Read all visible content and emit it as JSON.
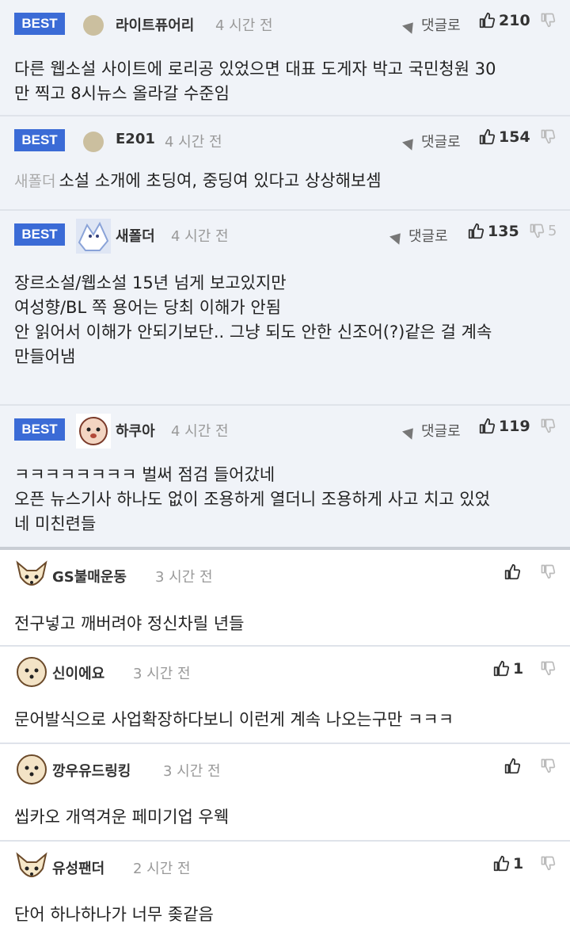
{
  "badge_label": "BEST",
  "reply_label": "댓글로",
  "best_comments": [
    {
      "nickname": "라이트퓨어리",
      "time": "4 시간 전",
      "upvotes": "210",
      "downvotes": "",
      "mention": "",
      "lines": [
        "다른 웹소설 사이트에 로리공 있었으면 대표 도게자 박고 국민청원 30",
        "만 찍고 8시뉴스 올라갈 수준임"
      ]
    },
    {
      "nickname": "E201",
      "time": "4 시간 전",
      "upvotes": "154",
      "downvotes": "",
      "mention": "새폴더",
      "lines": [
        "소설 소개에 초딩여, 중딩여 있다고 상상해보셈"
      ]
    },
    {
      "nickname": "새폴더",
      "time": "4 시간 전",
      "upvotes": "135",
      "downvotes": "5",
      "mention": "",
      "lines": [
        "장르소설/웹소설 15년 넘게 보고있지만",
        "",
        "여성향/BL 쪽 용어는 당최 이해가 안됨",
        "안 읽어서 이해가 안되기보단.. 그냥 되도 안한 신조어(?)같은 걸 계속",
        "만들어냄"
      ]
    },
    {
      "nickname": "하쿠아",
      "time": "4 시간 전",
      "upvotes": "119",
      "downvotes": "",
      "mention": "",
      "lines": [
        "ㅋㅋㅋㅋㅋㅋㅋㅋ 벌써 점검 들어갔네",
        "오픈 뉴스기사 하나도 없이 조용하게 열더니 조용하게 사고 치고 있었",
        "네 미친련들"
      ]
    }
  ],
  "comments": [
    {
      "nickname": "GS불매운동",
      "time": "3 시간 전",
      "upvotes": "",
      "text": "전구넣고 깨버려야 정신차릴 년들"
    },
    {
      "nickname": "신이에요",
      "time": "3 시간 전",
      "upvotes": "1",
      "text": "문어발식으로 사업확장하다보니 이런게 계속 나오는구만 ㅋㅋㅋ"
    },
    {
      "nickname": "깡우유드링킹",
      "time": "3 시간 전",
      "upvotes": "",
      "text": "씹카오 개역겨운 페미기업 우웩"
    },
    {
      "nickname": "유성팬더",
      "time": "2 시간 전",
      "upvotes": "1",
      "text": "단어 하나하나가 너무 좆같음"
    }
  ],
  "colors": {
    "best_bg": "#f0f3f8",
    "badge": "#3b6bd6",
    "text": "#222222",
    "muted": "#999999"
  }
}
